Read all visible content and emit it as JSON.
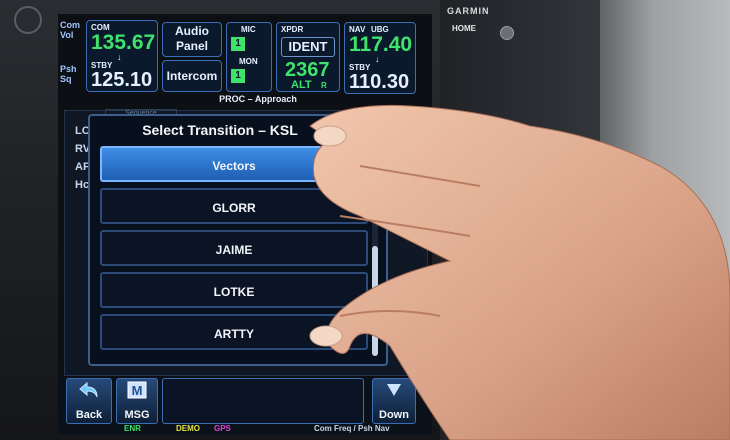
{
  "device": {
    "brand": "GARMIN",
    "home_label": "HOME"
  },
  "com": {
    "side_top": "Com\nVol",
    "side_bottom": "Psh\nSq",
    "label": "COM",
    "active": "135.67",
    "standby_label": "STBY",
    "standby": "125.10"
  },
  "audio": {
    "audio_panel_line1": "Audio",
    "audio_panel_line2": "Panel",
    "intercom": "Intercom"
  },
  "mic": {
    "mic_label": "MIC",
    "mic_value": "1",
    "mon_label": "MON",
    "mon_value": "1"
  },
  "xpdr": {
    "label": "XPDR",
    "ident": "IDENT",
    "code": "2367",
    "mode": "ALT",
    "reply": "R"
  },
  "nav": {
    "label": "NAV",
    "ident": "UBG",
    "active": "117.40",
    "standby_label": "STBY",
    "standby": "110.30"
  },
  "proc_title": "PROC – Approach",
  "background": {
    "tab": "Sequence",
    "rows": [
      "LO",
      "RV",
      "AF",
      "Hc"
    ]
  },
  "modal": {
    "title": "Select Transition – KSL",
    "options": [
      {
        "label": "Vectors",
        "selected": true
      },
      {
        "label": "GLORR",
        "selected": false
      },
      {
        "label": "JAIME",
        "selected": false
      },
      {
        "label": "LOTKE",
        "selected": false
      },
      {
        "label": "ARTTY",
        "selected": false
      }
    ]
  },
  "bottom": {
    "back": "Back",
    "msg": "MSG",
    "msg_icon_letter": "M",
    "down": "Down"
  },
  "status": {
    "enr": "ENR",
    "demo": "DEMO",
    "gps": "GPS",
    "hint": "Com Freq / Psh Nav"
  },
  "colors": {
    "active_green": "#3fe36b",
    "selected_blue": "#3f8ee6",
    "gps_magenta": "#e040e0",
    "demo_yellow": "#e6e040"
  }
}
